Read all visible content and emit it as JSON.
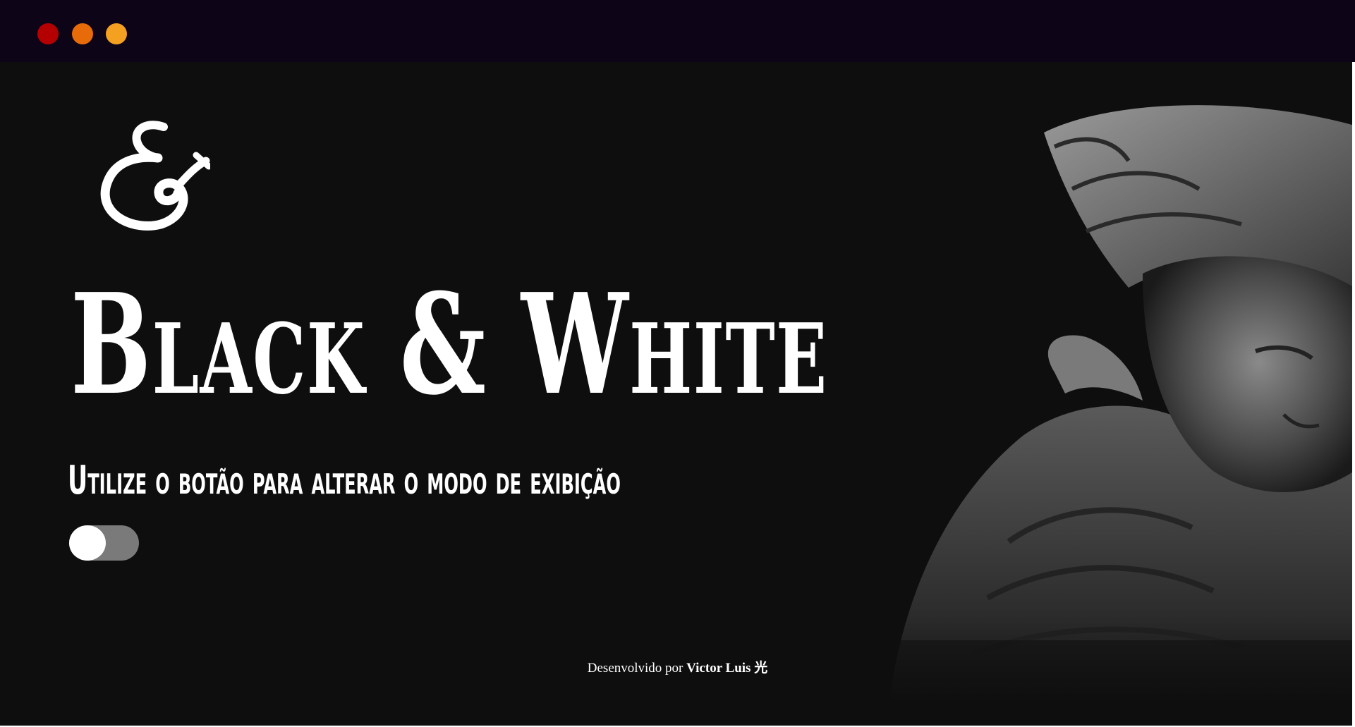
{
  "window": {
    "controls": [
      {
        "name": "close",
        "color": "#b40000"
      },
      {
        "name": "minimize",
        "color": "#e86b0a"
      },
      {
        "name": "maximize",
        "color": "#f4a020"
      }
    ]
  },
  "hero": {
    "logo_icon": "ampersand-icon",
    "title": "Black & White",
    "subtitle": "Utilize o botão para alterar o modo de exibição",
    "toggle": {
      "state": "off",
      "knob_color": "#ffffff",
      "track_color": "#7a7a7a"
    }
  },
  "image": {
    "subject": "statue-bust-image"
  },
  "footer": {
    "prefix": "Desenvolvido por ",
    "author": "Victor Luis",
    "glyph": "光"
  },
  "colors": {
    "background": "#0e0e0e",
    "window_bar": "#0d0418",
    "text": "#ffffff"
  }
}
